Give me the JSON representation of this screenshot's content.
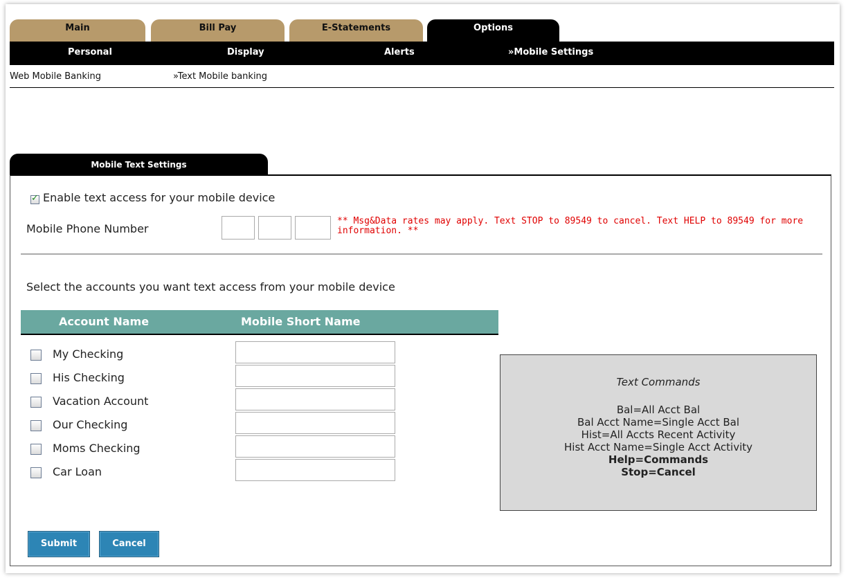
{
  "top_tabs": [
    {
      "label": "Main",
      "active": false
    },
    {
      "label": "Bill Pay",
      "active": false
    },
    {
      "label": "E-Statements",
      "active": false
    },
    {
      "label": "Options",
      "active": true
    }
  ],
  "subnav": [
    "Personal",
    "Display",
    "Alerts",
    "»Mobile Settings"
  ],
  "subsubnav": [
    "Web Mobile Banking",
    "»Text Mobile banking"
  ],
  "panel": {
    "tab_label": "Mobile Text Settings",
    "enable_label": "Enable text access for your mobile device",
    "enable_checked": true,
    "phone_label": "Mobile Phone Number",
    "disclaimer": "** Msg&Data rates may apply. Text STOP to 89549 to cancel. Text HELP to 89549 for more information. **",
    "select_prompt": "Select the accounts you want text access from your mobile device"
  },
  "table": {
    "header_account": "Account Name",
    "header_short": "Mobile Short Name",
    "rows": [
      {
        "name": "My Checking",
        "checked": false
      },
      {
        "name": "His Checking",
        "checked": false
      },
      {
        "name": "Vacation Account",
        "checked": false
      },
      {
        "name": "Our Checking",
        "checked": false
      },
      {
        "name": "Moms Checking",
        "checked": false
      },
      {
        "name": "Car Loan",
        "checked": false
      }
    ]
  },
  "commands": {
    "title": "Text Commands",
    "lines": [
      "Bal=All Acct Bal",
      "Bal Acct Name=Single Acct Bal",
      "Hist=All Accts Recent Activity",
      "Hist Acct Name=Single Acct Activity"
    ],
    "bold_lines": [
      "Help=Commands",
      "Stop=Cancel"
    ]
  },
  "buttons": {
    "submit": "Submit",
    "cancel": "Cancel"
  },
  "colors": {
    "tab_tan": "#b79a6b",
    "header_teal": "#6aa8a0",
    "button_blue": "#2d85b5",
    "disclaimer_red": "#e00000"
  }
}
